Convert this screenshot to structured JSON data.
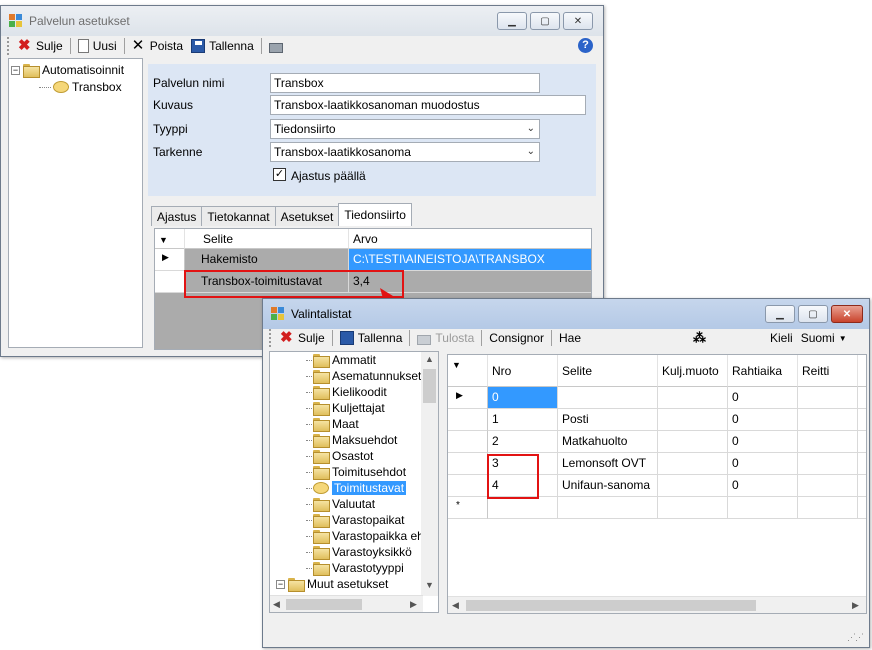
{
  "win1": {
    "title": "Palvelun asetukset",
    "toolbar": {
      "close": "Sulje",
      "new": "Uusi",
      "delete": "Poista",
      "save": "Tallenna"
    },
    "tree": {
      "root": "Automatisoinnit",
      "child": "Transbox"
    },
    "form": {
      "name_label": "Palvelun nimi",
      "name_value": "Transbox",
      "desc_label": "Kuvaus",
      "desc_value": "Transbox-laatikkosanoman muodostus",
      "type_label": "Tyyppi",
      "type_value": "Tiedonsiirto",
      "detail_label": "Tarkenne",
      "detail_value": "Transbox-laatikkosanoma",
      "schedule_label": "Ajastus päällä",
      "schedule_checked": true
    },
    "tabs": [
      "Ajastus",
      "Tietokannat",
      "Asetukset",
      "Tiedonsiirto"
    ],
    "grid": {
      "headers": [
        "Selite",
        "Arvo"
      ],
      "rows": [
        {
          "label": "Hakemisto",
          "value": "C:\\TESTI\\AINEISTOJA\\TRANSBOX"
        },
        {
          "label": "Transbox-toimitustavat",
          "value": "3,4"
        }
      ]
    }
  },
  "win2": {
    "title": "Valintalistat",
    "toolbar": {
      "close": "Sulje",
      "save": "Tallenna",
      "print": "Tulosta",
      "consignor": "Consignor",
      "search": "Hae",
      "lang_label": "Kieli",
      "lang_value": "Suomi"
    },
    "tree": [
      "Ammatit",
      "Asematunnukset",
      "Kielikoodit",
      "Kuljettajat",
      "Maat",
      "Maksuehdot",
      "Osastot",
      "Toimitusehdot",
      "Toimitustavat",
      "Valuutat",
      "Varastopaikat",
      "Varastopaikka ehdot",
      "Varastoyksikkö",
      "Varastotyyppi",
      "Muut asetukset"
    ],
    "grid": {
      "headers": [
        "Nro",
        "Selite",
        "Kulj.muoto",
        "Rahtiaika",
        "Reitti"
      ],
      "rows": [
        {
          "nro": "0",
          "selite": "",
          "kulj": "",
          "rahti": "0",
          "reitti": ""
        },
        {
          "nro": "1",
          "selite": "Posti",
          "kulj": "",
          "rahti": "0",
          "reitti": ""
        },
        {
          "nro": "2",
          "selite": "Matkahuolto",
          "kulj": "",
          "rahti": "0",
          "reitti": ""
        },
        {
          "nro": "3",
          "selite": "Lemonsoft OVT",
          "kulj": "",
          "rahti": "0",
          "reitti": ""
        },
        {
          "nro": "4",
          "selite": "Unifaun-sanoma",
          "kulj": "",
          "rahti": "0",
          "reitti": ""
        }
      ]
    }
  },
  "colors": {
    "accent": "#3399ff",
    "highlight": "#e21313"
  }
}
